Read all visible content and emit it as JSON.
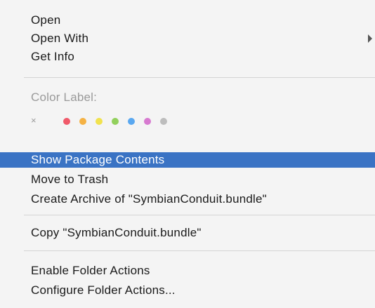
{
  "menu": {
    "open": "Open",
    "open_with": "Open With",
    "get_info": "Get Info",
    "color_label": "Color Label:",
    "color_clear_symbol": "×",
    "color_dots": [
      "#f05a6a",
      "#f5b244",
      "#f1e24e",
      "#92d05c",
      "#5aa8f0",
      "#d77ad0",
      "#bdbdbd"
    ],
    "show_package_contents": "Show Package Contents",
    "move_to_trash": "Move to Trash",
    "create_archive": "Create Archive of \"SymbianConduit.bundle\"",
    "copy": "Copy \"SymbianConduit.bundle\"",
    "enable_folder_actions": "Enable Folder Actions",
    "configure_folder_actions": "Configure Folder Actions..."
  },
  "colors": {
    "highlight": "#3a73c4",
    "disabled_text": "#9a9a9a"
  }
}
